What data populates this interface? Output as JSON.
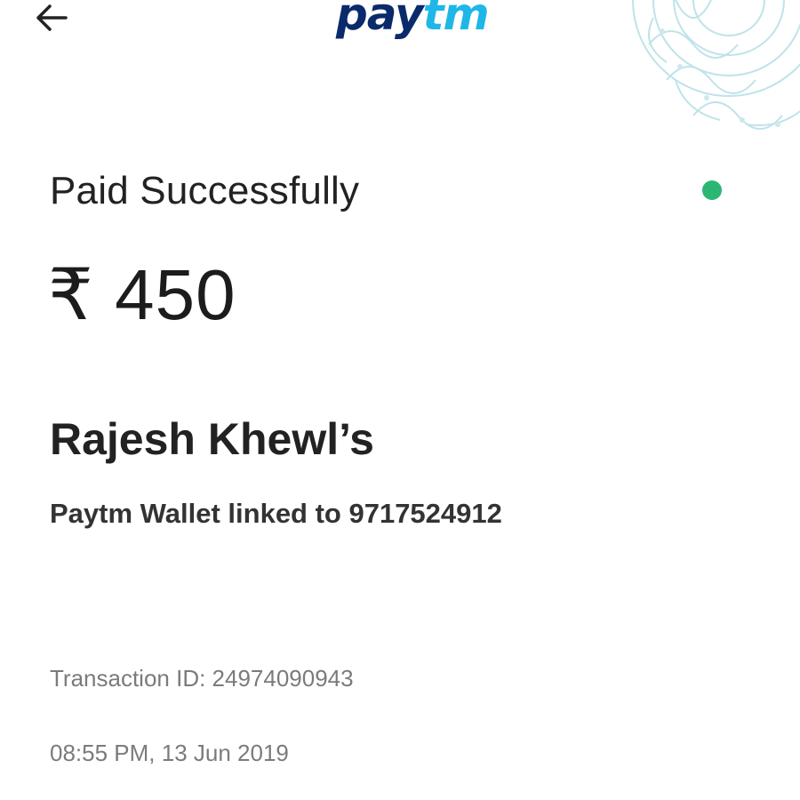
{
  "header": {
    "back_icon": "arrow-left-icon",
    "logo_part1": "pay",
    "logo_part2": "tm",
    "brand_colors": {
      "dark": "#0b2a6b",
      "light": "#1fb6e8"
    }
  },
  "payment": {
    "status": "Paid Successfully",
    "status_dot_color": "#2bb673",
    "amount": "₹ 450",
    "payee_name": "Rajesh Khewl’s",
    "payee_detail": "Paytm Wallet linked to 9717524912",
    "transaction_id": "Transaction ID: 24974090943",
    "timestamp": "08:55 PM, 13 Jun 2019"
  }
}
